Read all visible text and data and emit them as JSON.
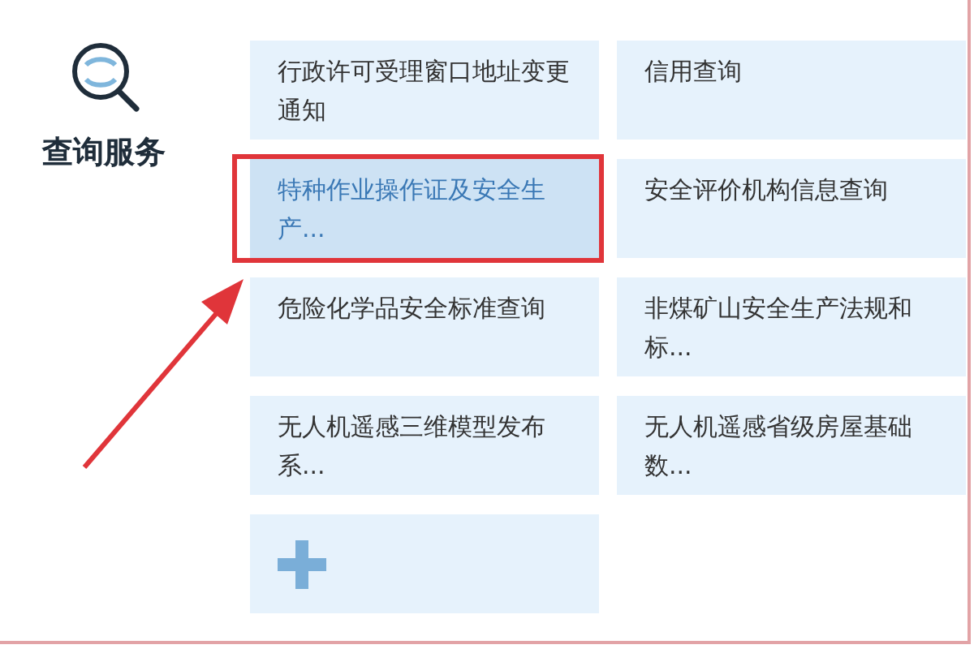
{
  "section": {
    "title": "查询服务"
  },
  "tiles": [
    {
      "kind": "link",
      "label": "行政许可受理窗口地址变更通知",
      "selected": false
    },
    {
      "kind": "link",
      "label": "信用查询",
      "selected": false
    },
    {
      "kind": "link",
      "label": "特种作业操作证及安全生产...",
      "selected": true
    },
    {
      "kind": "link",
      "label": "安全评价机构信息查询",
      "selected": false
    },
    {
      "kind": "link",
      "label": "危险化学品安全标准查询",
      "selected": false
    },
    {
      "kind": "link",
      "label": "非煤矿山安全生产法规和标...",
      "selected": false
    },
    {
      "kind": "link",
      "label": "无人机遥感三维模型发布系...",
      "selected": false
    },
    {
      "kind": "link",
      "label": "无人机遥感省级房屋基础数...",
      "selected": false
    },
    {
      "kind": "add",
      "selected": false
    }
  ]
}
